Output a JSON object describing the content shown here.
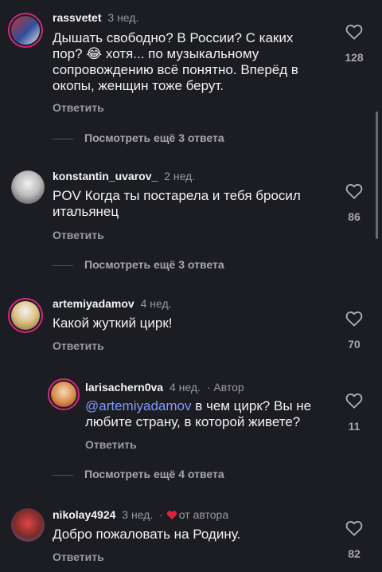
{
  "comments": [
    {
      "username": "rassvetet",
      "time": "3 нед.",
      "text": "Дышать свободно? В России? С каких пор? 😂 хотя... по музыкальному сопровождению всё понятно. Вперёд в окопы, женщин тоже берут.",
      "reply_label": "Ответить",
      "likes": "128",
      "more_replies": "Посмотреть ещё 3 ответа",
      "avatar_color": "#3a5aa8"
    },
    {
      "username": "konstantin_uvarov_",
      "time": "2 нед.",
      "text": "POV Когда ты постарела и тебя бросил итальянец",
      "reply_label": "Ответить",
      "likes": "86",
      "more_replies": "Посмотреть ещё 3 ответа",
      "avatar_color": "#d9d9d9"
    },
    {
      "username": "artemiyadamov",
      "time": "4 нед.",
      "text": "Какой жуткий цирк!",
      "reply_label": "Ответить",
      "likes": "70",
      "avatar_color": "#c9a96a"
    },
    {
      "username": "larisachern0va",
      "time": "4 нед.",
      "author_badge": "· Автор",
      "mention": "@artemiyadamov",
      "text": "в чем цирк? Вы не любите страну, в которой живете?",
      "reply_label": "Ответить",
      "likes": "11",
      "more_replies": "Посмотреть ещё 4 ответа",
      "avatar_color": "#d98a4a"
    },
    {
      "username": "nikolay4924",
      "time": "3 нед.",
      "from_author": "от автора",
      "text": "Добро пожаловать на Родину.",
      "reply_label": "Ответить",
      "likes": "82",
      "avatar_color": "#c43b3b"
    }
  ]
}
